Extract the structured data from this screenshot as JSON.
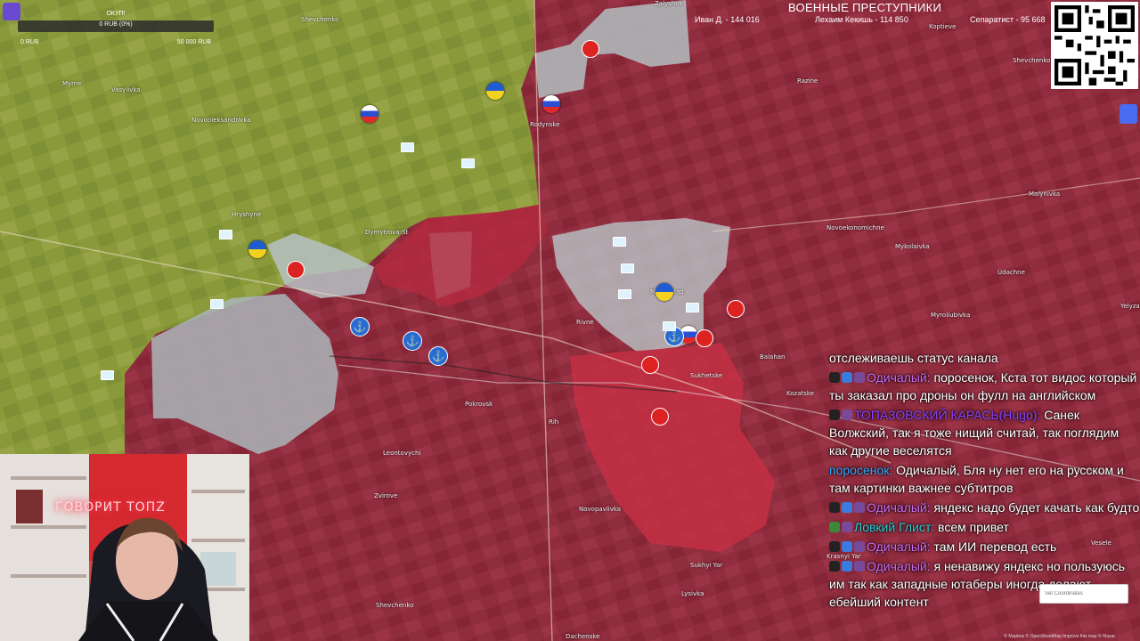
{
  "stream": {
    "donation_goal": {
      "title": "ОКУП!",
      "value": "0 RUB (0%)",
      "min": "0 RUB",
      "max": "50 000 RUB"
    },
    "header_title": "ВОЕННЫЕ ПРЕСТУПНИКИ",
    "donors": [
      "Иван Д. - 144 016",
      "Лехаим Кекишь - 114 850",
      "Сепаратист - 95 668"
    ],
    "webcam_neon_text": "ГОВОРИТ TOПZ"
  },
  "map_labels": [
    "Zalyshok",
    "Shevchenko",
    "Myrne",
    "Vasylivka",
    "Novooleksandrivka",
    "Rodynske",
    "Hryshyne",
    "Pokrovsk",
    "Leontovychi",
    "Zvirove",
    "Shevchenko",
    "Novopavlivka",
    "Sukhyi Yar",
    "Lysivka",
    "Dachenske",
    "Rivne",
    "Rih",
    "Balahan",
    "Kozatske",
    "Novoekonomichne",
    "Mykolaivka",
    "Myroliubivka",
    "Malynivka",
    "Razine",
    "Koptieve",
    "Shevchenko Pershe",
    "Udachne",
    "Yelyzavetivka",
    "Krasnyi Yar",
    "Vesele",
    "Myrnohrad",
    "Sukhetske",
    "Dymytrova-St"
  ],
  "chat": {
    "messages": [
      {
        "nick": "",
        "text": "отслеживаешь статус канала"
      },
      {
        "nick": "Одичалый:",
        "nick_color": "pink",
        "text": "поросенок, Кста тот видос который ты заказал про дроны он фулл на английском"
      },
      {
        "nick": "ТОПАЗОВСКИЙ КАРАСЬ(Hugo):",
        "nick_color": "purple",
        "text": "Санек Волжский, так я тоже нищий считай, так поглядим как другие веселятся"
      },
      {
        "nick": "поросенок:",
        "nick_color": "blue",
        "text": "Одичалый, Бля ну нет его на русском и там картинки важнее субтитров"
      },
      {
        "nick": "Одичалый:",
        "nick_color": "pink",
        "text": "яндекс надо будет качать как будто"
      },
      {
        "nick": "Ловкий Глист:",
        "nick_color": "teal",
        "text": "всем привет"
      },
      {
        "nick": "Одичалый:",
        "nick_color": "pink",
        "text": "там ИИ перевод есть"
      },
      {
        "nick": "Одичалый:",
        "nick_color": "pink",
        "text": "я ненавижу яндекс но пользуюсь им так как западные ютаберы иногда делают ебейший контент"
      }
    ]
  },
  "map_controls": {
    "coordinates_placeholder": "Set Coordinates",
    "attribution": "© Mapbox © OpenStreetMap Improve this map © Maxar"
  },
  "colors": {
    "occupied": "#a5283e",
    "contested": "#c43044",
    "controlled": "#8d9a3e",
    "gray_zone": "#b4c0c4",
    "neon": "#ff3a55"
  }
}
